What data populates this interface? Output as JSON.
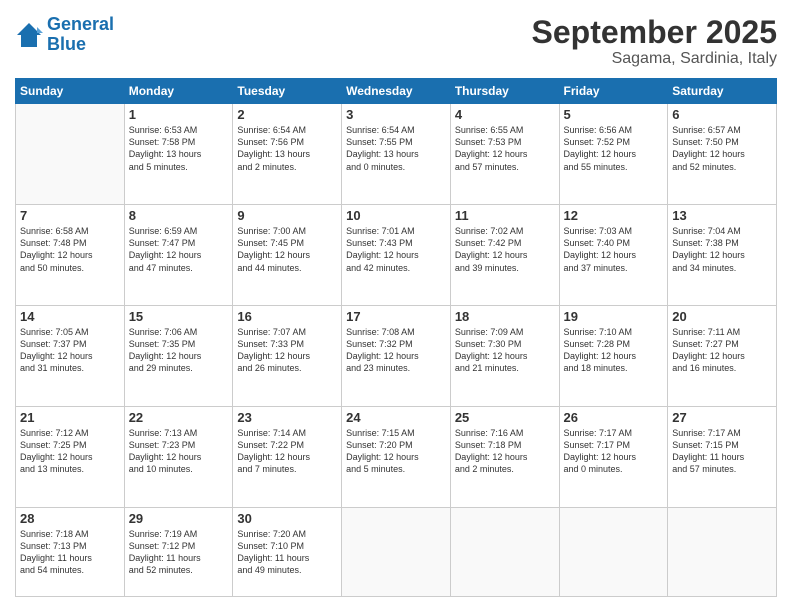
{
  "header": {
    "logo_line1": "General",
    "logo_line2": "Blue",
    "month": "September 2025",
    "location": "Sagama, Sardinia, Italy"
  },
  "days_of_week": [
    "Sunday",
    "Monday",
    "Tuesday",
    "Wednesday",
    "Thursday",
    "Friday",
    "Saturday"
  ],
  "weeks": [
    [
      {
        "day": "",
        "info": ""
      },
      {
        "day": "1",
        "info": "Sunrise: 6:53 AM\nSunset: 7:58 PM\nDaylight: 13 hours\nand 5 minutes."
      },
      {
        "day": "2",
        "info": "Sunrise: 6:54 AM\nSunset: 7:56 PM\nDaylight: 13 hours\nand 2 minutes."
      },
      {
        "day": "3",
        "info": "Sunrise: 6:54 AM\nSunset: 7:55 PM\nDaylight: 13 hours\nand 0 minutes."
      },
      {
        "day": "4",
        "info": "Sunrise: 6:55 AM\nSunset: 7:53 PM\nDaylight: 12 hours\nand 57 minutes."
      },
      {
        "day": "5",
        "info": "Sunrise: 6:56 AM\nSunset: 7:52 PM\nDaylight: 12 hours\nand 55 minutes."
      },
      {
        "day": "6",
        "info": "Sunrise: 6:57 AM\nSunset: 7:50 PM\nDaylight: 12 hours\nand 52 minutes."
      }
    ],
    [
      {
        "day": "7",
        "info": "Sunrise: 6:58 AM\nSunset: 7:48 PM\nDaylight: 12 hours\nand 50 minutes."
      },
      {
        "day": "8",
        "info": "Sunrise: 6:59 AM\nSunset: 7:47 PM\nDaylight: 12 hours\nand 47 minutes."
      },
      {
        "day": "9",
        "info": "Sunrise: 7:00 AM\nSunset: 7:45 PM\nDaylight: 12 hours\nand 44 minutes."
      },
      {
        "day": "10",
        "info": "Sunrise: 7:01 AM\nSunset: 7:43 PM\nDaylight: 12 hours\nand 42 minutes."
      },
      {
        "day": "11",
        "info": "Sunrise: 7:02 AM\nSunset: 7:42 PM\nDaylight: 12 hours\nand 39 minutes."
      },
      {
        "day": "12",
        "info": "Sunrise: 7:03 AM\nSunset: 7:40 PM\nDaylight: 12 hours\nand 37 minutes."
      },
      {
        "day": "13",
        "info": "Sunrise: 7:04 AM\nSunset: 7:38 PM\nDaylight: 12 hours\nand 34 minutes."
      }
    ],
    [
      {
        "day": "14",
        "info": "Sunrise: 7:05 AM\nSunset: 7:37 PM\nDaylight: 12 hours\nand 31 minutes."
      },
      {
        "day": "15",
        "info": "Sunrise: 7:06 AM\nSunset: 7:35 PM\nDaylight: 12 hours\nand 29 minutes."
      },
      {
        "day": "16",
        "info": "Sunrise: 7:07 AM\nSunset: 7:33 PM\nDaylight: 12 hours\nand 26 minutes."
      },
      {
        "day": "17",
        "info": "Sunrise: 7:08 AM\nSunset: 7:32 PM\nDaylight: 12 hours\nand 23 minutes."
      },
      {
        "day": "18",
        "info": "Sunrise: 7:09 AM\nSunset: 7:30 PM\nDaylight: 12 hours\nand 21 minutes."
      },
      {
        "day": "19",
        "info": "Sunrise: 7:10 AM\nSunset: 7:28 PM\nDaylight: 12 hours\nand 18 minutes."
      },
      {
        "day": "20",
        "info": "Sunrise: 7:11 AM\nSunset: 7:27 PM\nDaylight: 12 hours\nand 16 minutes."
      }
    ],
    [
      {
        "day": "21",
        "info": "Sunrise: 7:12 AM\nSunset: 7:25 PM\nDaylight: 12 hours\nand 13 minutes."
      },
      {
        "day": "22",
        "info": "Sunrise: 7:13 AM\nSunset: 7:23 PM\nDaylight: 12 hours\nand 10 minutes."
      },
      {
        "day": "23",
        "info": "Sunrise: 7:14 AM\nSunset: 7:22 PM\nDaylight: 12 hours\nand 7 minutes."
      },
      {
        "day": "24",
        "info": "Sunrise: 7:15 AM\nSunset: 7:20 PM\nDaylight: 12 hours\nand 5 minutes."
      },
      {
        "day": "25",
        "info": "Sunrise: 7:16 AM\nSunset: 7:18 PM\nDaylight: 12 hours\nand 2 minutes."
      },
      {
        "day": "26",
        "info": "Sunrise: 7:17 AM\nSunset: 7:17 PM\nDaylight: 12 hours\nand 0 minutes."
      },
      {
        "day": "27",
        "info": "Sunrise: 7:17 AM\nSunset: 7:15 PM\nDaylight: 11 hours\nand 57 minutes."
      }
    ],
    [
      {
        "day": "28",
        "info": "Sunrise: 7:18 AM\nSunset: 7:13 PM\nDaylight: 11 hours\nand 54 minutes."
      },
      {
        "day": "29",
        "info": "Sunrise: 7:19 AM\nSunset: 7:12 PM\nDaylight: 11 hours\nand 52 minutes."
      },
      {
        "day": "30",
        "info": "Sunrise: 7:20 AM\nSunset: 7:10 PM\nDaylight: 11 hours\nand 49 minutes."
      },
      {
        "day": "",
        "info": ""
      },
      {
        "day": "",
        "info": ""
      },
      {
        "day": "",
        "info": ""
      },
      {
        "day": "",
        "info": ""
      }
    ]
  ]
}
